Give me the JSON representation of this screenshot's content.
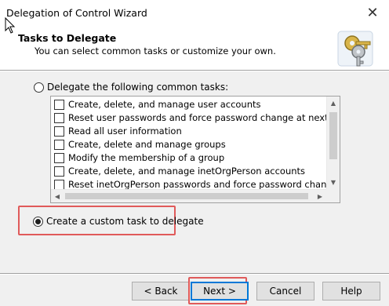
{
  "window": {
    "title": "Delegation of Control Wizard",
    "close_glyph": "✕"
  },
  "header": {
    "title": "Tasks to Delegate",
    "subtitle": "You can select common tasks or customize your own.",
    "icon": "keys-icon"
  },
  "options": {
    "common_tasks_label": "Delegate the following common tasks:",
    "common_tasks_selected": false,
    "custom_task_label": "Create a custom task to delegate",
    "custom_task_selected": true
  },
  "tasks": [
    "Create, delete, and manage user accounts",
    "Reset user passwords and force password change at next logon",
    "Read all user information",
    "Create, delete and manage groups",
    "Modify the membership of a group",
    "Create, delete, and manage inetOrgPerson accounts",
    "Reset inetOrgPerson passwords and force password change at next lo"
  ],
  "buttons": {
    "back": "< Back",
    "next": "Next >",
    "cancel": "Cancel",
    "help": "Help"
  },
  "colors": {
    "highlight": "#e05a5a",
    "default_button_border": "#0078d7",
    "background": "#f0f0f0"
  }
}
